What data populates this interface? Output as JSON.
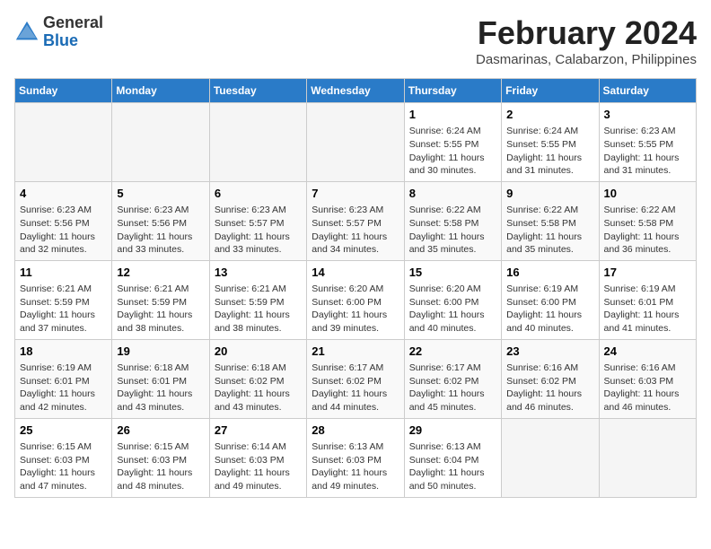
{
  "header": {
    "logo_line1": "General",
    "logo_line2": "Blue",
    "month": "February 2024",
    "location": "Dasmarinas, Calabarzon, Philippines"
  },
  "weekdays": [
    "Sunday",
    "Monday",
    "Tuesday",
    "Wednesday",
    "Thursday",
    "Friday",
    "Saturday"
  ],
  "rows": [
    [
      {
        "day": "",
        "info": ""
      },
      {
        "day": "",
        "info": ""
      },
      {
        "day": "",
        "info": ""
      },
      {
        "day": "",
        "info": ""
      },
      {
        "day": "1",
        "info": "Sunrise: 6:24 AM\nSunset: 5:55 PM\nDaylight: 11 hours\nand 30 minutes."
      },
      {
        "day": "2",
        "info": "Sunrise: 6:24 AM\nSunset: 5:55 PM\nDaylight: 11 hours\nand 31 minutes."
      },
      {
        "day": "3",
        "info": "Sunrise: 6:23 AM\nSunset: 5:55 PM\nDaylight: 11 hours\nand 31 minutes."
      }
    ],
    [
      {
        "day": "4",
        "info": "Sunrise: 6:23 AM\nSunset: 5:56 PM\nDaylight: 11 hours\nand 32 minutes."
      },
      {
        "day": "5",
        "info": "Sunrise: 6:23 AM\nSunset: 5:56 PM\nDaylight: 11 hours\nand 33 minutes."
      },
      {
        "day": "6",
        "info": "Sunrise: 6:23 AM\nSunset: 5:57 PM\nDaylight: 11 hours\nand 33 minutes."
      },
      {
        "day": "7",
        "info": "Sunrise: 6:23 AM\nSunset: 5:57 PM\nDaylight: 11 hours\nand 34 minutes."
      },
      {
        "day": "8",
        "info": "Sunrise: 6:22 AM\nSunset: 5:58 PM\nDaylight: 11 hours\nand 35 minutes."
      },
      {
        "day": "9",
        "info": "Sunrise: 6:22 AM\nSunset: 5:58 PM\nDaylight: 11 hours\nand 35 minutes."
      },
      {
        "day": "10",
        "info": "Sunrise: 6:22 AM\nSunset: 5:58 PM\nDaylight: 11 hours\nand 36 minutes."
      }
    ],
    [
      {
        "day": "11",
        "info": "Sunrise: 6:21 AM\nSunset: 5:59 PM\nDaylight: 11 hours\nand 37 minutes."
      },
      {
        "day": "12",
        "info": "Sunrise: 6:21 AM\nSunset: 5:59 PM\nDaylight: 11 hours\nand 38 minutes."
      },
      {
        "day": "13",
        "info": "Sunrise: 6:21 AM\nSunset: 5:59 PM\nDaylight: 11 hours\nand 38 minutes."
      },
      {
        "day": "14",
        "info": "Sunrise: 6:20 AM\nSunset: 6:00 PM\nDaylight: 11 hours\nand 39 minutes."
      },
      {
        "day": "15",
        "info": "Sunrise: 6:20 AM\nSunset: 6:00 PM\nDaylight: 11 hours\nand 40 minutes."
      },
      {
        "day": "16",
        "info": "Sunrise: 6:19 AM\nSunset: 6:00 PM\nDaylight: 11 hours\nand 40 minutes."
      },
      {
        "day": "17",
        "info": "Sunrise: 6:19 AM\nSunset: 6:01 PM\nDaylight: 11 hours\nand 41 minutes."
      }
    ],
    [
      {
        "day": "18",
        "info": "Sunrise: 6:19 AM\nSunset: 6:01 PM\nDaylight: 11 hours\nand 42 minutes."
      },
      {
        "day": "19",
        "info": "Sunrise: 6:18 AM\nSunset: 6:01 PM\nDaylight: 11 hours\nand 43 minutes."
      },
      {
        "day": "20",
        "info": "Sunrise: 6:18 AM\nSunset: 6:02 PM\nDaylight: 11 hours\nand 43 minutes."
      },
      {
        "day": "21",
        "info": "Sunrise: 6:17 AM\nSunset: 6:02 PM\nDaylight: 11 hours\nand 44 minutes."
      },
      {
        "day": "22",
        "info": "Sunrise: 6:17 AM\nSunset: 6:02 PM\nDaylight: 11 hours\nand 45 minutes."
      },
      {
        "day": "23",
        "info": "Sunrise: 6:16 AM\nSunset: 6:02 PM\nDaylight: 11 hours\nand 46 minutes."
      },
      {
        "day": "24",
        "info": "Sunrise: 6:16 AM\nSunset: 6:03 PM\nDaylight: 11 hours\nand 46 minutes."
      }
    ],
    [
      {
        "day": "25",
        "info": "Sunrise: 6:15 AM\nSunset: 6:03 PM\nDaylight: 11 hours\nand 47 minutes."
      },
      {
        "day": "26",
        "info": "Sunrise: 6:15 AM\nSunset: 6:03 PM\nDaylight: 11 hours\nand 48 minutes."
      },
      {
        "day": "27",
        "info": "Sunrise: 6:14 AM\nSunset: 6:03 PM\nDaylight: 11 hours\nand 49 minutes."
      },
      {
        "day": "28",
        "info": "Sunrise: 6:13 AM\nSunset: 6:03 PM\nDaylight: 11 hours\nand 49 minutes."
      },
      {
        "day": "29",
        "info": "Sunrise: 6:13 AM\nSunset: 6:04 PM\nDaylight: 11 hours\nand 50 minutes."
      },
      {
        "day": "",
        "info": ""
      },
      {
        "day": "",
        "info": ""
      }
    ]
  ]
}
